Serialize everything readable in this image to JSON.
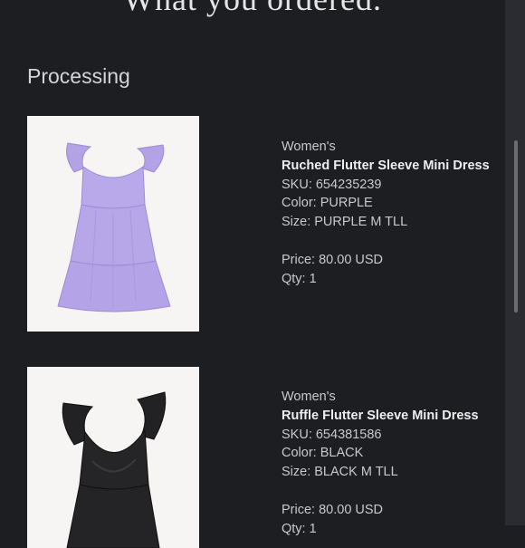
{
  "header": {
    "title": "What you ordered."
  },
  "section": {
    "heading": "Processing"
  },
  "items": [
    {
      "category": "Women's",
      "name": "Ruched Flutter Sleeve Mini Dress",
      "sku": "SKU: 654235239",
      "color": "Color: PURPLE",
      "size": "Size: PURPLE M TLL",
      "price": "Price: 80.00 USD",
      "qty": "Qty: 1",
      "image_color": "#b7a6e8"
    },
    {
      "category": "Women's",
      "name": "Ruffle Flutter Sleeve Mini Dress",
      "sku": "SKU: 654381586",
      "color": "Color: BLACK",
      "size": "Size: BLACK M TLL",
      "price": "Price: 80.00 USD",
      "qty": "Qty: 1",
      "image_color": "#232325"
    }
  ]
}
